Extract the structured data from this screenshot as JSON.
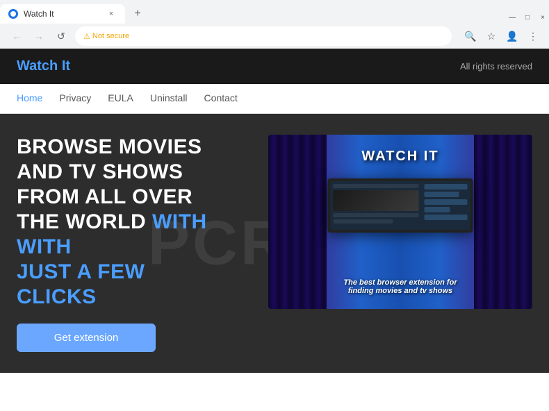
{
  "browser": {
    "tab_title": "Watch It",
    "tab_favicon": "circle",
    "close_tab": "×",
    "new_tab": "+",
    "window_minimize": "—",
    "window_maximize": "□",
    "window_close": "×",
    "nav_back": "←",
    "nav_forward": "→",
    "nav_reload": "↺",
    "security_icon": "⚠",
    "security_text": "Not secure",
    "address_url": "",
    "search_icon": "🔍",
    "bookmark_icon": "☆",
    "profile_icon": "👤",
    "menu_icon": "⋮"
  },
  "site": {
    "logo": "Watch It",
    "copyright": "All rights reserved",
    "nav": {
      "items": [
        {
          "label": "Home",
          "active": true
        },
        {
          "label": "Privacy",
          "active": false
        },
        {
          "label": "EULA",
          "active": false
        },
        {
          "label": "Uninstall",
          "active": false
        },
        {
          "label": "Contact",
          "active": false
        }
      ]
    },
    "hero": {
      "title_line1": "BROWSE MOVIES",
      "title_line2": "AND TV SHOWS",
      "title_line3": "FROM ALL OVER",
      "title_line4": "THE WORLD",
      "title_highlight": "WITH",
      "title_line5": "JUST A FEW",
      "title_line6": "CLICKS",
      "cta_button": "Get extension",
      "watermark": "PCRISK",
      "image_title": "WATCH IT",
      "image_subtitle": "The best browser extension for\nfinding movies and tv shows"
    }
  }
}
